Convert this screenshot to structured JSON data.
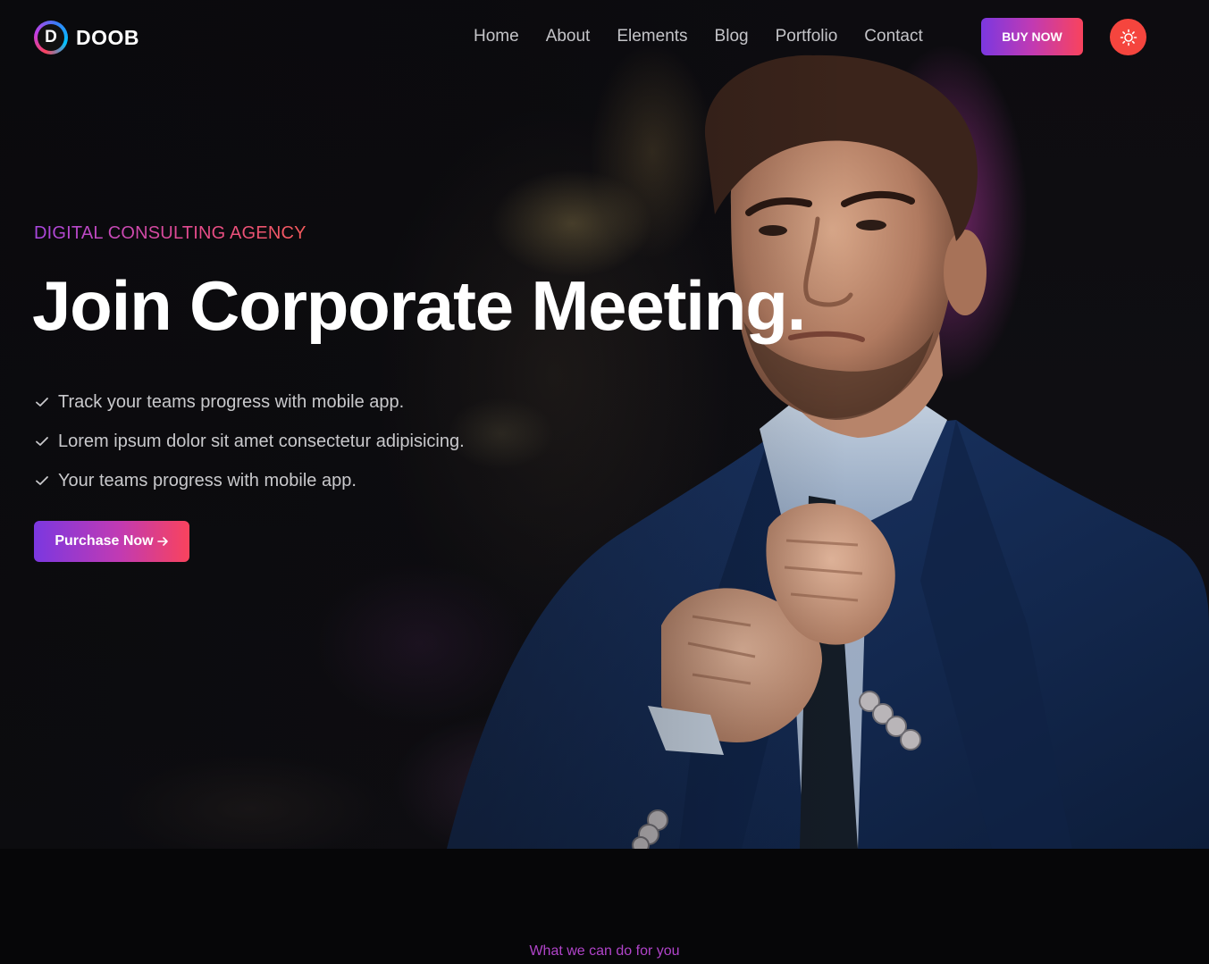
{
  "brand": {
    "logo_letter": "D",
    "name": "DOOB"
  },
  "nav": {
    "items": [
      {
        "label": "Home"
      },
      {
        "label": "About"
      },
      {
        "label": "Elements"
      },
      {
        "label": "Blog"
      },
      {
        "label": "Portfolio"
      },
      {
        "label": "Contact"
      }
    ],
    "buy_label": "BUY NOW",
    "theme_icon": "sun-icon"
  },
  "hero": {
    "subtitle": "DIGITAL CONSULTING AGENCY",
    "title": "Join Corporate Meeting.",
    "features": [
      "Track your teams progress with mobile app.",
      "Lorem ipsum dolor sit amet consectetur adipisicing.",
      "Your teams progress with mobile app."
    ],
    "cta_label": "Purchase Now"
  },
  "services": {
    "subtitle": "What we can do for you"
  },
  "colors": {
    "gradient_start": "#7b38e0",
    "gradient_mid": "#c13ab3",
    "gradient_end": "#f9435d",
    "theme_button": "#f5453e",
    "background": "#060608"
  }
}
